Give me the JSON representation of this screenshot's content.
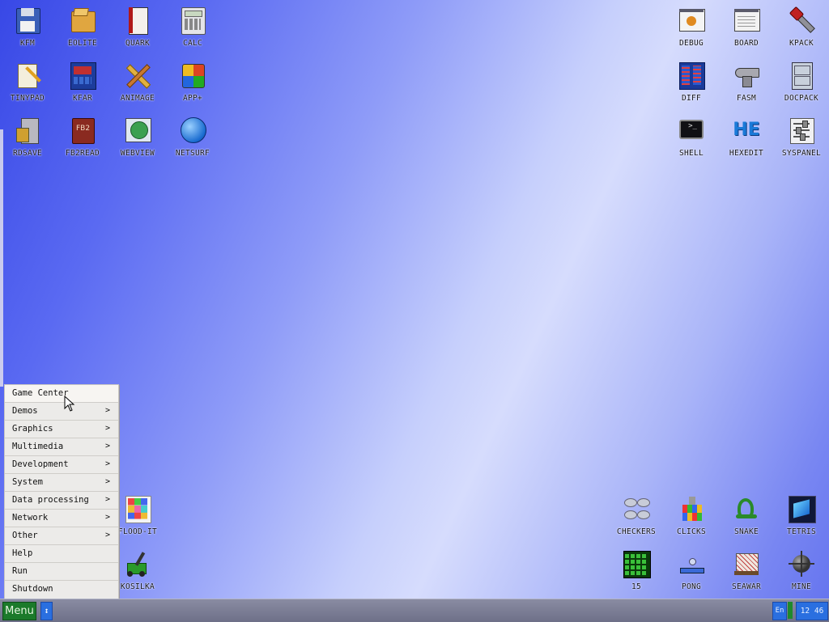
{
  "desktop_icons_left": [
    {
      "id": "kfm",
      "label": "KFM",
      "icon": "floppy-disk-icon"
    },
    {
      "id": "eolite",
      "label": "EOLITE",
      "icon": "folder-icon"
    },
    {
      "id": "quark",
      "label": "QUARK",
      "icon": "notebook-icon"
    },
    {
      "id": "calc",
      "label": "CALC",
      "icon": "calculator-icon"
    },
    {
      "id": "tinypad",
      "label": "TINYPAD",
      "icon": "notepad-pencil-icon"
    },
    {
      "id": "kfar",
      "label": "KFAR",
      "icon": "blue-panels-icon"
    },
    {
      "id": "animage",
      "label": "ANIMAGE",
      "icon": "pencil-ruler-icon"
    },
    {
      "id": "appplus",
      "label": "APP+",
      "icon": "rubiks-cube-icon"
    },
    {
      "id": "rdsave",
      "label": "RDSAVE",
      "icon": "disk-server-icon"
    },
    {
      "id": "fb2read",
      "label": "FB2READ",
      "icon": "book-icon"
    },
    {
      "id": "webview",
      "label": "WEBVIEW",
      "icon": "globe-window-icon"
    },
    {
      "id": "netsurf",
      "label": "NETSURF",
      "icon": "globe-icon"
    }
  ],
  "desktop_icons_right": [
    {
      "id": "debug",
      "label": "DEBUG",
      "icon": "bug-window-icon"
    },
    {
      "id": "board",
      "label": "BOARD",
      "icon": "window-text-icon"
    },
    {
      "id": "kpack",
      "label": "KPACK",
      "icon": "wrench-icon"
    },
    {
      "id": "diff",
      "label": "DIFF",
      "icon": "two-columns-icon"
    },
    {
      "id": "fasm",
      "label": "FASM",
      "icon": "anvil-icon"
    },
    {
      "id": "docpack",
      "label": "DOCPACK",
      "icon": "cabinet-icon"
    },
    {
      "id": "shell",
      "label": "SHELL",
      "icon": "terminal-icon"
    },
    {
      "id": "hexedit",
      "label": "HEXEDIT",
      "icon": "hex-letters-icon"
    },
    {
      "id": "syspanel",
      "label": "SYSPANEL",
      "icon": "sliders-icon"
    }
  ],
  "desktop_icons_games": [
    {
      "id": "flood",
      "label": "FLOOD-IT",
      "icon": "color-grid-icon"
    },
    {
      "id": "kosilka",
      "label": "KOSILKA",
      "icon": "lawnmower-icon"
    },
    {
      "id": "checkers",
      "label": "CHECKERS",
      "icon": "checkers-icon"
    },
    {
      "id": "clicks",
      "label": "CLICKS",
      "icon": "blocks-icon"
    },
    {
      "id": "snake",
      "label": "SNAKE",
      "icon": "snake-icon"
    },
    {
      "id": "tetris",
      "label": "TETRIS",
      "icon": "tetris-icon"
    },
    {
      "id": "fifteen",
      "label": "15",
      "icon": "green-grid-icon"
    },
    {
      "id": "pong",
      "label": "PONG",
      "icon": "paddle-ball-icon"
    },
    {
      "id": "seawar",
      "label": "SEAWAR",
      "icon": "ship-icon"
    },
    {
      "id": "mine",
      "label": "MINE",
      "icon": "mine-icon"
    }
  ],
  "start_menu": {
    "items": [
      {
        "label": "Game Center",
        "submenu": false
      },
      {
        "label": "Demos",
        "submenu": true
      },
      {
        "label": "Graphics",
        "submenu": true
      },
      {
        "label": "Multimedia",
        "submenu": true
      },
      {
        "label": "Development",
        "submenu": true
      },
      {
        "label": "System",
        "submenu": true
      },
      {
        "label": "Data processing",
        "submenu": true
      },
      {
        "label": "Network",
        "submenu": true
      },
      {
        "label": "Other",
        "submenu": true
      },
      {
        "label": "Help",
        "submenu": false
      },
      {
        "label": "Run",
        "submenu": false
      },
      {
        "label": "Shutdown",
        "submenu": false
      }
    ],
    "arrow_glyph": ">"
  },
  "taskbar": {
    "menu_label": "Menu",
    "switch_glyph": "↕",
    "language": "En",
    "clock": "12 46",
    "colors": {
      "menu_button": "#1b7a2a",
      "blue_buttons": "#2a6fe0"
    }
  }
}
